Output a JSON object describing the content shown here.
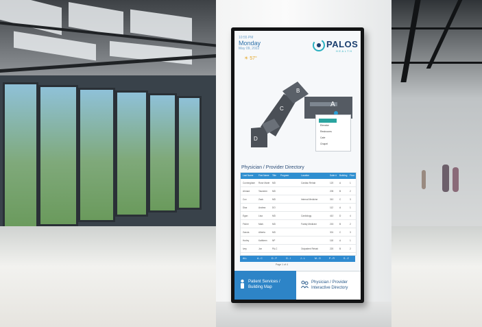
{
  "sign": {
    "date_time": "10:55 PM",
    "day": "Monday",
    "date": "May 09, 2022",
    "weather": "57°",
    "brand": {
      "name": "PALOS",
      "sub": "HEALTH"
    },
    "building_labels": [
      "A",
      "B",
      "C",
      "D"
    ],
    "legend_items": [
      "Elevator",
      "Restrooms",
      "Cafe",
      "Chapel"
    ],
    "directory_title": "Physician / Provider Directory",
    "table_headers": [
      "Last Name",
      "First Name",
      "Title",
      "Program",
      "Location",
      "Suite #",
      "Building",
      "Floor"
    ],
    "table_rows": [
      [
        "Cunningham",
        "Rose Marie",
        "MD",
        "",
        "Cardiac Rehab",
        "120",
        "A",
        "1"
      ],
      [
        "Ahmad",
        "Tasneem",
        "MD",
        "",
        "",
        "205",
        "B",
        "2"
      ],
      [
        "Cox",
        "Zack",
        "MD",
        "",
        "Internal Medicine",
        "310",
        "C",
        "3"
      ],
      [
        "Diaz",
        "Andrea",
        "DO",
        "",
        "",
        "112",
        "A",
        "1"
      ],
      [
        "Egan",
        "Lisa",
        "MD",
        "",
        "Cardiology",
        "410",
        "D",
        "4"
      ],
      [
        "Fisher",
        "Mark",
        "MD",
        "",
        "Family Medicine",
        "215",
        "B",
        "2"
      ],
      [
        "Garcia",
        "Alberto",
        "MD",
        "",
        "",
        "301",
        "C",
        "3"
      ],
      [
        "Hurley",
        "Kathleen",
        "NP",
        "",
        "",
        "118",
        "A",
        "1"
      ],
      [
        "Ivey",
        "Jon",
        "PA-C",
        "",
        "Outpatient Rehab",
        "220",
        "B",
        "2"
      ]
    ],
    "alpha_tabs": [
      "ALL",
      "A - C",
      "D - F",
      "G - I",
      "J - L",
      "M - O",
      "P - R",
      "S - Z"
    ],
    "pager": "Page 1 of 4",
    "footer_left": [
      "Patient Services /",
      "Building Map"
    ],
    "footer_right": [
      "Physician / Provider",
      "Interactive Directory"
    ]
  }
}
